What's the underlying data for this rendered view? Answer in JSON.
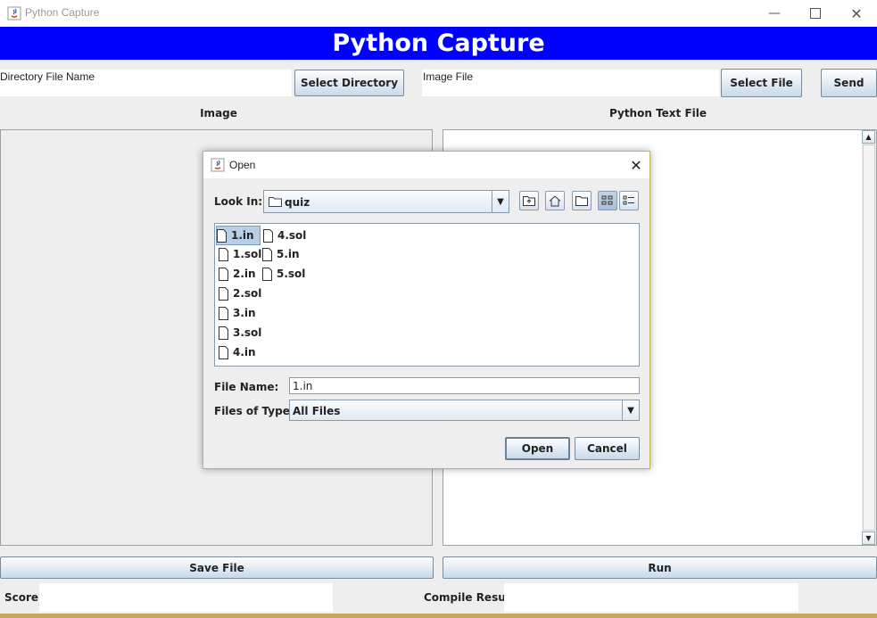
{
  "window": {
    "title": "Python Capture"
  },
  "banner": {
    "title": "Python Capture"
  },
  "top": {
    "directory_label": "Directory File Name",
    "select_directory": "Select Directory",
    "image_label": "Image File",
    "select_file": "Select File",
    "send": "Send"
  },
  "panels": {
    "image_label": "Image",
    "text_label": "Python Text File"
  },
  "bottom": {
    "save_file": "Save File",
    "run": "Run",
    "score_label": "Score",
    "compile_label": "Compile Result"
  },
  "dialog": {
    "title": "Open",
    "look_in_label": "Look In:",
    "look_in_value": "quiz",
    "files_col1": [
      "1.in",
      "1.sol",
      "2.in",
      "2.sol",
      "3.in",
      "3.sol",
      "4.in"
    ],
    "files_col2": [
      "4.sol",
      "5.in",
      "5.sol"
    ],
    "file_name_label": "File Name:",
    "file_name_value": "1.in",
    "files_of_type_label": "Files of Type:",
    "files_of_type_value": "All Files",
    "open": "Open",
    "cancel": "Cancel"
  },
  "colors": {
    "banner": "#0000ff",
    "selection": "#b8cfe5",
    "dialog_border": "#c8b24a"
  },
  "icons": [
    "java-app-icon",
    "minimize-icon",
    "maximize-icon",
    "close-icon",
    "folder-icon",
    "up-folder-icon",
    "home-icon",
    "new-folder-icon",
    "list-view-icon",
    "details-view-icon",
    "file-icon"
  ]
}
